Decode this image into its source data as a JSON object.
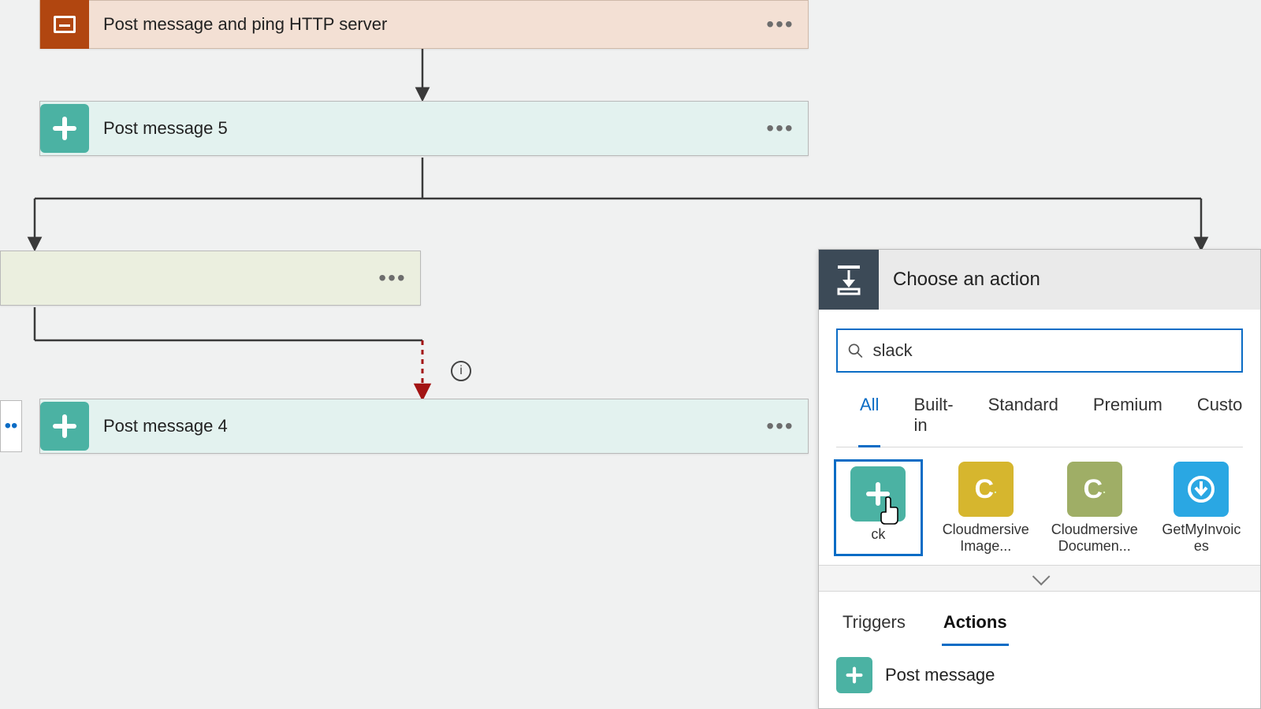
{
  "workflow": {
    "scope_title": "Post message and ping HTTP server",
    "step2_title": "Post message 5",
    "step3_title": "Post message 4"
  },
  "panel": {
    "title": "Choose an action",
    "search_value": "slack",
    "search_placeholder": "",
    "filter_tabs": [
      "All",
      "Built-in",
      "Standard",
      "Premium",
      "Custo"
    ],
    "filter_active_index": 0,
    "connectors": [
      {
        "name": "Slack",
        "label_visible": "ck",
        "tile": "slackt",
        "selected": true
      },
      {
        "name": "Cloudmersive Image",
        "label_visible": "Cloudmersive Image...",
        "tile": "cm-y"
      },
      {
        "name": "Cloudmersive Document",
        "label_visible": "Cloudmersive Documen...",
        "tile": "cm-g"
      },
      {
        "name": "GetMyInvoices",
        "label_visible": "GetMyInvoic es",
        "tile": "gmi"
      }
    ],
    "subtabs": [
      "Triggers",
      "Actions"
    ],
    "subtabs_active_index": 1,
    "results": [
      {
        "title": "Post message"
      }
    ]
  },
  "colors": {
    "accent": "#0a6cc5",
    "slack": "#4bb2a3",
    "scope": "#b14610"
  }
}
